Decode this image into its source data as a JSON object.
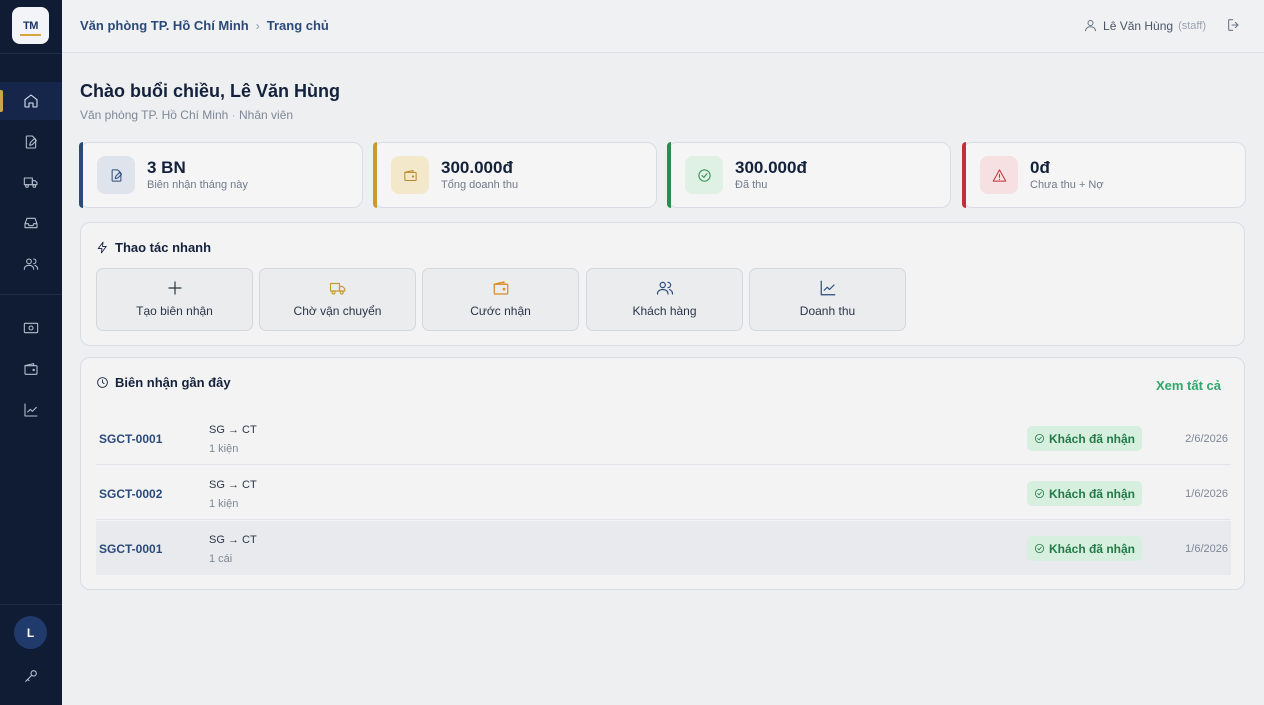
{
  "logo": {
    "text": "TM"
  },
  "breadcrumb": {
    "office": "Văn phòng TP. Hồ Chí Minh",
    "separator": "›",
    "page": "Trang chủ"
  },
  "user": {
    "name": "Lê Văn Hùng",
    "role": "(staff)",
    "initial": "L"
  },
  "greeting": {
    "title": "Chào buổi chiều, Lê Văn Hùng",
    "office": "Văn phòng TP. Hồ Chí Minh",
    "dot": "·",
    "position": "Nhân viên"
  },
  "stats": [
    {
      "value": "3 BN",
      "label": "Biên nhận tháng này"
    },
    {
      "value": "300.000đ",
      "label": "Tổng doanh thu"
    },
    {
      "value": "300.000đ",
      "label": "Đã thu"
    },
    {
      "value": "0đ",
      "label": "Chưa thu + Nợ"
    }
  ],
  "quick": {
    "title": "Thao tác nhanh",
    "actions": [
      {
        "label": "Tạo biên nhận"
      },
      {
        "label": "Chờ vận chuyển"
      },
      {
        "label": "Cước nhận"
      },
      {
        "label": "Khách hàng"
      },
      {
        "label": "Doanh thu"
      }
    ]
  },
  "recent": {
    "title": "Biên nhận gần đây",
    "view_all": "Xem tất cả",
    "rows": [
      {
        "code": "SGCT-0001",
        "route": "SG → CT",
        "qty": "1 kiện",
        "status": "Khách đã nhận",
        "date": "2/6/2026"
      },
      {
        "code": "SGCT-0002",
        "route": "SG → CT",
        "qty": "1 kiện",
        "status": "Khách đã nhận",
        "date": "1/6/2026"
      },
      {
        "code": "SGCT-0001",
        "route": "SG → CT",
        "qty": "1 cái",
        "status": "Khách đã nhận",
        "date": "1/6/2026"
      }
    ]
  },
  "colors": {
    "sidebar": "#0f1c33",
    "brand": "#2a4a7a",
    "accent_gold": "#c99a2e",
    "success": "#2e8b4f",
    "danger": "#c0303a"
  }
}
